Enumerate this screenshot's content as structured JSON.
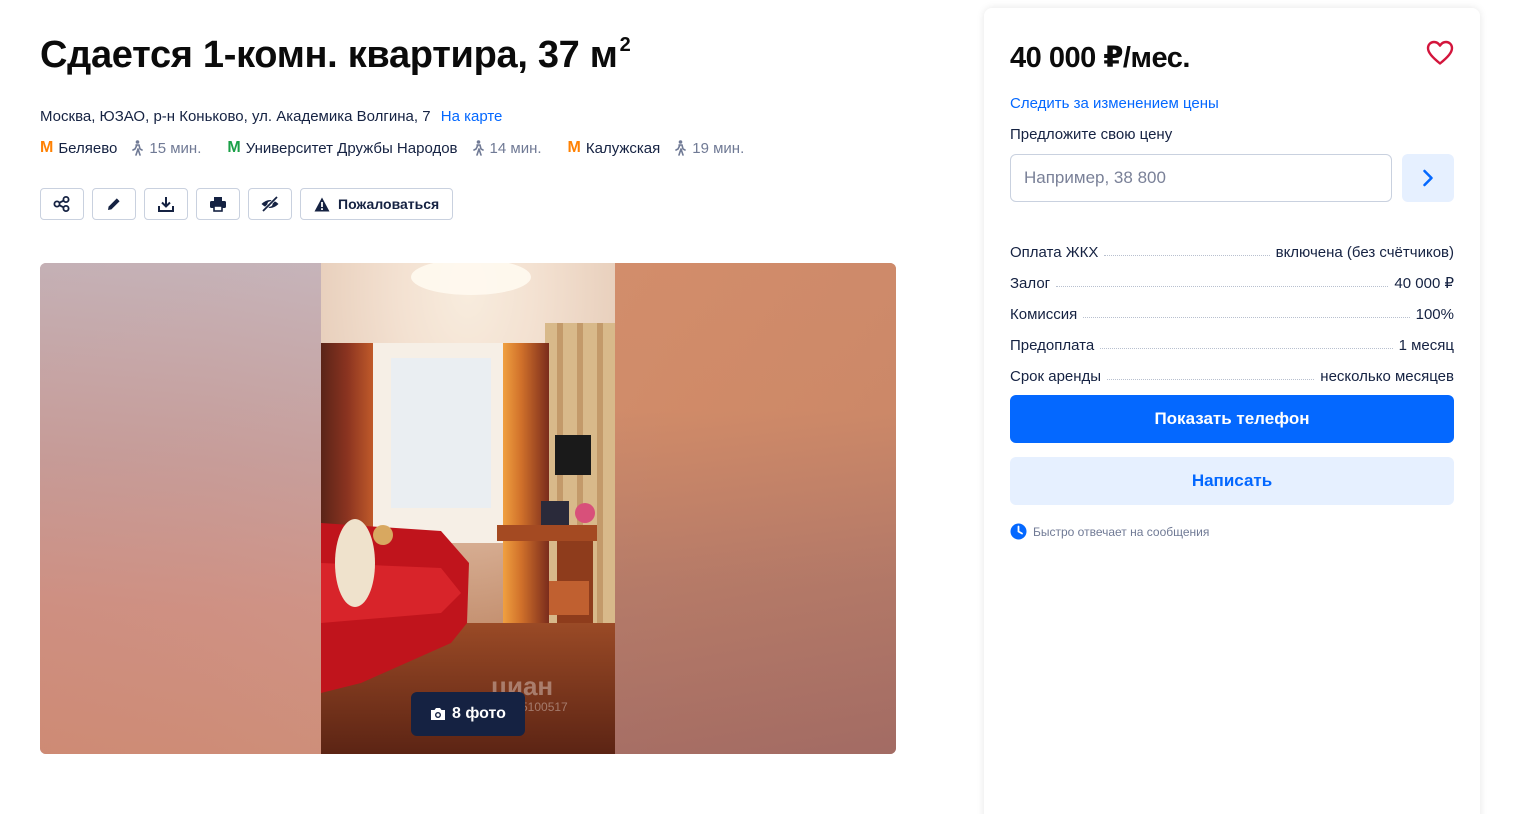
{
  "listing": {
    "title": "Сдается 1-комн. квартира, 37 м",
    "title_sup": "2",
    "address": "Москва, ЮЗАО, р-н Коньково, ул. Академика Волгина, 7",
    "map_link": "На карте",
    "metro": [
      {
        "name": "Беляево",
        "time": "15 мин.",
        "color": "#ff8103"
      },
      {
        "name": "Университет Дружбы Народов",
        "time": "14 мин.",
        "color": "#1ba048"
      },
      {
        "name": "Калужская",
        "time": "19 мин.",
        "color": "#ff8103"
      }
    ],
    "metro_icon": "М"
  },
  "actions": {
    "icons": [
      "share-icon",
      "edit-icon",
      "download-icon",
      "print-icon",
      "hide-icon"
    ],
    "report_label": "Пожаловаться"
  },
  "gallery": {
    "photo_count_label": "8 фото",
    "watermark": "циан",
    "watermark_id": "5100517"
  },
  "sidebar": {
    "price": "40 000 ₽/мес.",
    "track_price": "Следить за изменением цены",
    "offer_label": "Предложите свою цену",
    "offer_placeholder": "Например, 38 800",
    "terms": [
      {
        "label": "Оплата ЖКХ",
        "value": "включена (без счётчиков)"
      },
      {
        "label": "Залог",
        "value": "40 000 ₽"
      },
      {
        "label": "Комиссия",
        "value": "100%"
      },
      {
        "label": "Предоплата",
        "value": "1 месяц"
      },
      {
        "label": "Срок аренды",
        "value": "несколько месяцев"
      }
    ],
    "show_phone": "Показать телефон",
    "write": "Написать",
    "fast_reply": "Быстро отвечает на сообщения"
  },
  "colors": {
    "accent": "#0468ff",
    "accent_light": "#e6f0ff",
    "heart": "#d3153c",
    "dark": "#152242"
  }
}
